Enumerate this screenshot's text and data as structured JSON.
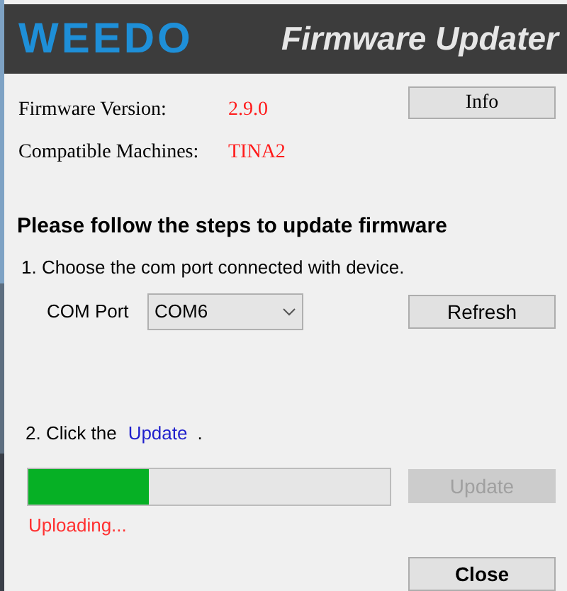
{
  "header": {
    "logo": "WEEDO",
    "title": "Firmware Updater"
  },
  "info": [
    {
      "label": "Firmware Version:",
      "value": "2.9.0"
    },
    {
      "label": "Compatible Machines:",
      "value": "TINA2"
    }
  ],
  "info_button": {
    "label": "Info",
    "disabled": false
  },
  "heading": "Please follow the steps to update firmware",
  "step1": {
    "text": "1. Choose the com port connected with device.",
    "port_label": "COM Port",
    "port_value": "COM6",
    "refresh_button": {
      "label": "Refresh",
      "disabled": false
    }
  },
  "step2": {
    "text": "2. Click the",
    "link": "Update",
    "end": "."
  },
  "progress": {
    "level": 0.333
  },
  "update_button": {
    "label": "Update",
    "disabled": true
  },
  "status": "Uploading...",
  "close_button": {
    "label": "Close",
    "disabled": false
  }
}
